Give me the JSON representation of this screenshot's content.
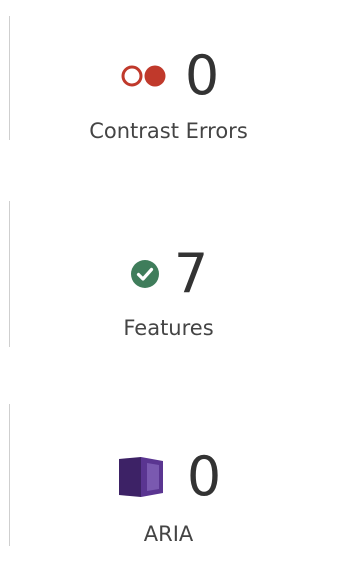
{
  "summary": {
    "contrast_errors": {
      "count": "0",
      "label": "Contrast Errors",
      "icon": "contrast-icon",
      "color": "#c0392b"
    },
    "features": {
      "count": "7",
      "label": "Features",
      "icon": "check-circle-icon",
      "color": "#3f7d5b"
    },
    "aria": {
      "count": "0",
      "label": "ARIA",
      "icon": "aria-box-icon",
      "color": "#4b2a7b"
    }
  }
}
